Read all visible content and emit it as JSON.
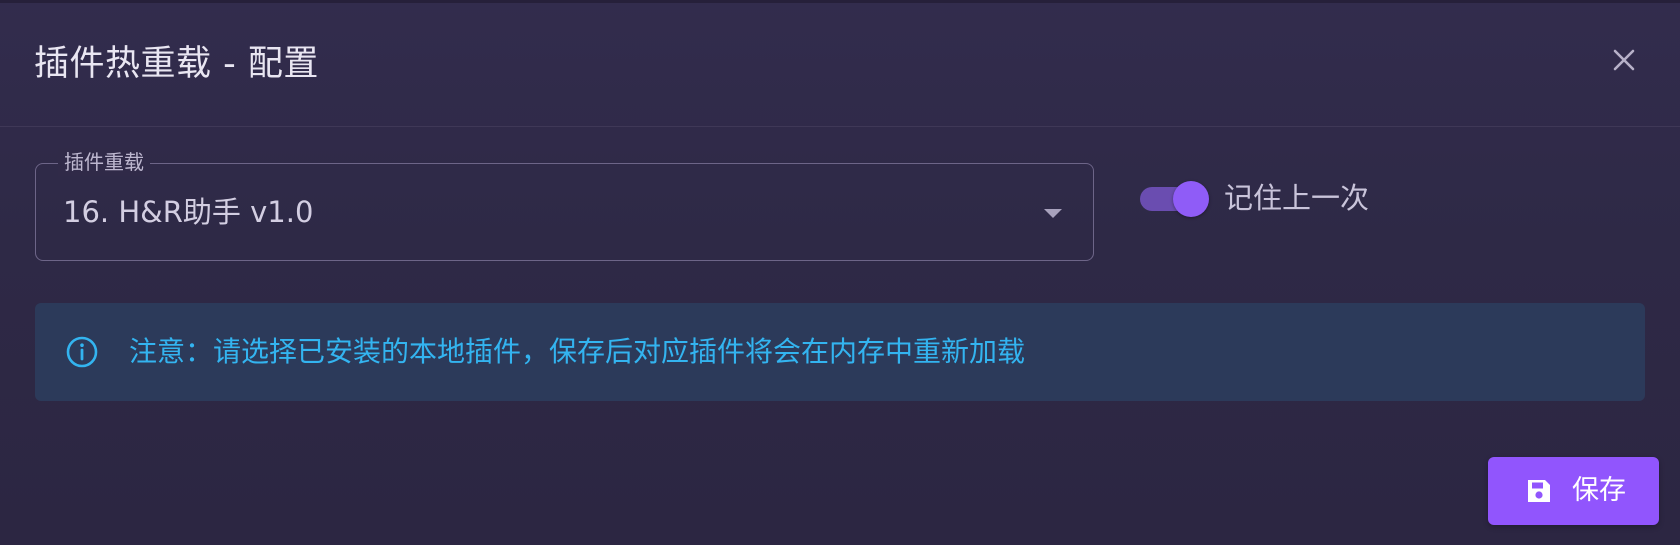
{
  "dialog": {
    "title": "插件热重载 - 配置",
    "close_icon": "close-icon"
  },
  "form": {
    "select": {
      "label": "插件重载",
      "value": "16. H&R助手 v1.0",
      "icon": "chevron-down-icon"
    },
    "toggle": {
      "label": "记住上一次",
      "checked": true
    }
  },
  "alert": {
    "icon": "info-icon",
    "text": "注意：请选择已安装的本地插件，保存后对应插件将会在内存中重新加载",
    "color": "#33b4f0"
  },
  "actions": {
    "save_label": "保存",
    "save_icon": "save-icon"
  },
  "colors": {
    "accent": "#9155fd",
    "background": "#2e2946",
    "alert_background": "#2c3a5a"
  }
}
